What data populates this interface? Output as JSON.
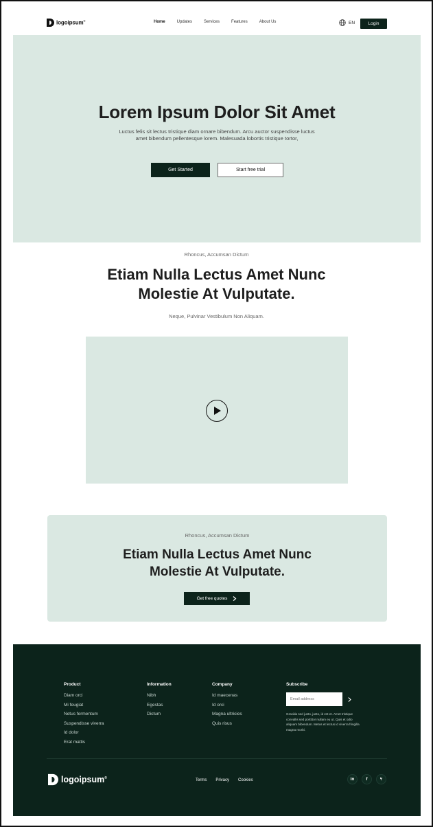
{
  "nav": {
    "logo_text": "logoipsum",
    "logo_sup": "®",
    "items": [
      {
        "label": "Home",
        "active": true
      },
      {
        "label": "Updates",
        "active": false
      },
      {
        "label": "Services",
        "active": false
      },
      {
        "label": "Features",
        "active": false
      },
      {
        "label": "About Us",
        "active": false
      }
    ],
    "language": "EN",
    "login_label": "Login"
  },
  "hero": {
    "title": "Lorem Ipsum Dolor Sit Amet",
    "description": "Luctus felis sit lectus tristique diam ornare bibendum. Arcu auctor suspendisse luctus amet bibendum pellentesque lorem. Malesuada lobortis tristique tortor,",
    "primary_button": "Get Started",
    "secondary_button": "Start free trial"
  },
  "feature": {
    "eyebrow": "Rhoncus, Accumsan Dictum",
    "title_line1": "Etiam Nulla Lectus Amet Nunc",
    "title_line2": "Molestie At Vulputate.",
    "subtitle": "Neque, Pulvinar Vestibulum Non Aliquam."
  },
  "cta": {
    "eyebrow": "Rhoncus, Accumsan Dictum",
    "title_line1": "Etiam Nulla Lectus Amet Nunc",
    "title_line2": "Molestie At Vulputate.",
    "button_label": "Get free quotes"
  },
  "footer": {
    "columns": [
      {
        "heading": "Product",
        "links": [
          "Diam orci",
          "Mi feugiat",
          "Netus fermentum",
          "Suspendisse viverra",
          "Id dolor",
          "Erat mattis"
        ]
      },
      {
        "heading": "Information",
        "links": [
          "Nibh",
          "Egestas",
          "Dictum"
        ]
      },
      {
        "heading": "Company",
        "links": [
          "Id maecenas",
          "Id orci",
          "Magna ultricies",
          "Quis risus"
        ]
      }
    ],
    "subscribe": {
      "heading": "Subscribe",
      "placeholder": "Email address",
      "note": "Gravida sed justo, justo, id est et. Amet tristique convallis sed porttitor nullam eu ut. Quis et odio aliquam bibendum. Metus et lectus id viverra fringilla magna morbi."
    },
    "logo_text": "logoipsum",
    "logo_sup": "®",
    "bottom_links": [
      "Terms",
      "Privacy",
      "Cookies"
    ],
    "social": [
      {
        "icon": "linkedin-icon",
        "glyph": "in"
      },
      {
        "icon": "facebook-icon",
        "glyph": "f"
      },
      {
        "icon": "share-icon",
        "glyph": "⑂"
      }
    ]
  },
  "colors": {
    "accent_dark": "#0c231b",
    "mint_background": "#dae8e2"
  }
}
